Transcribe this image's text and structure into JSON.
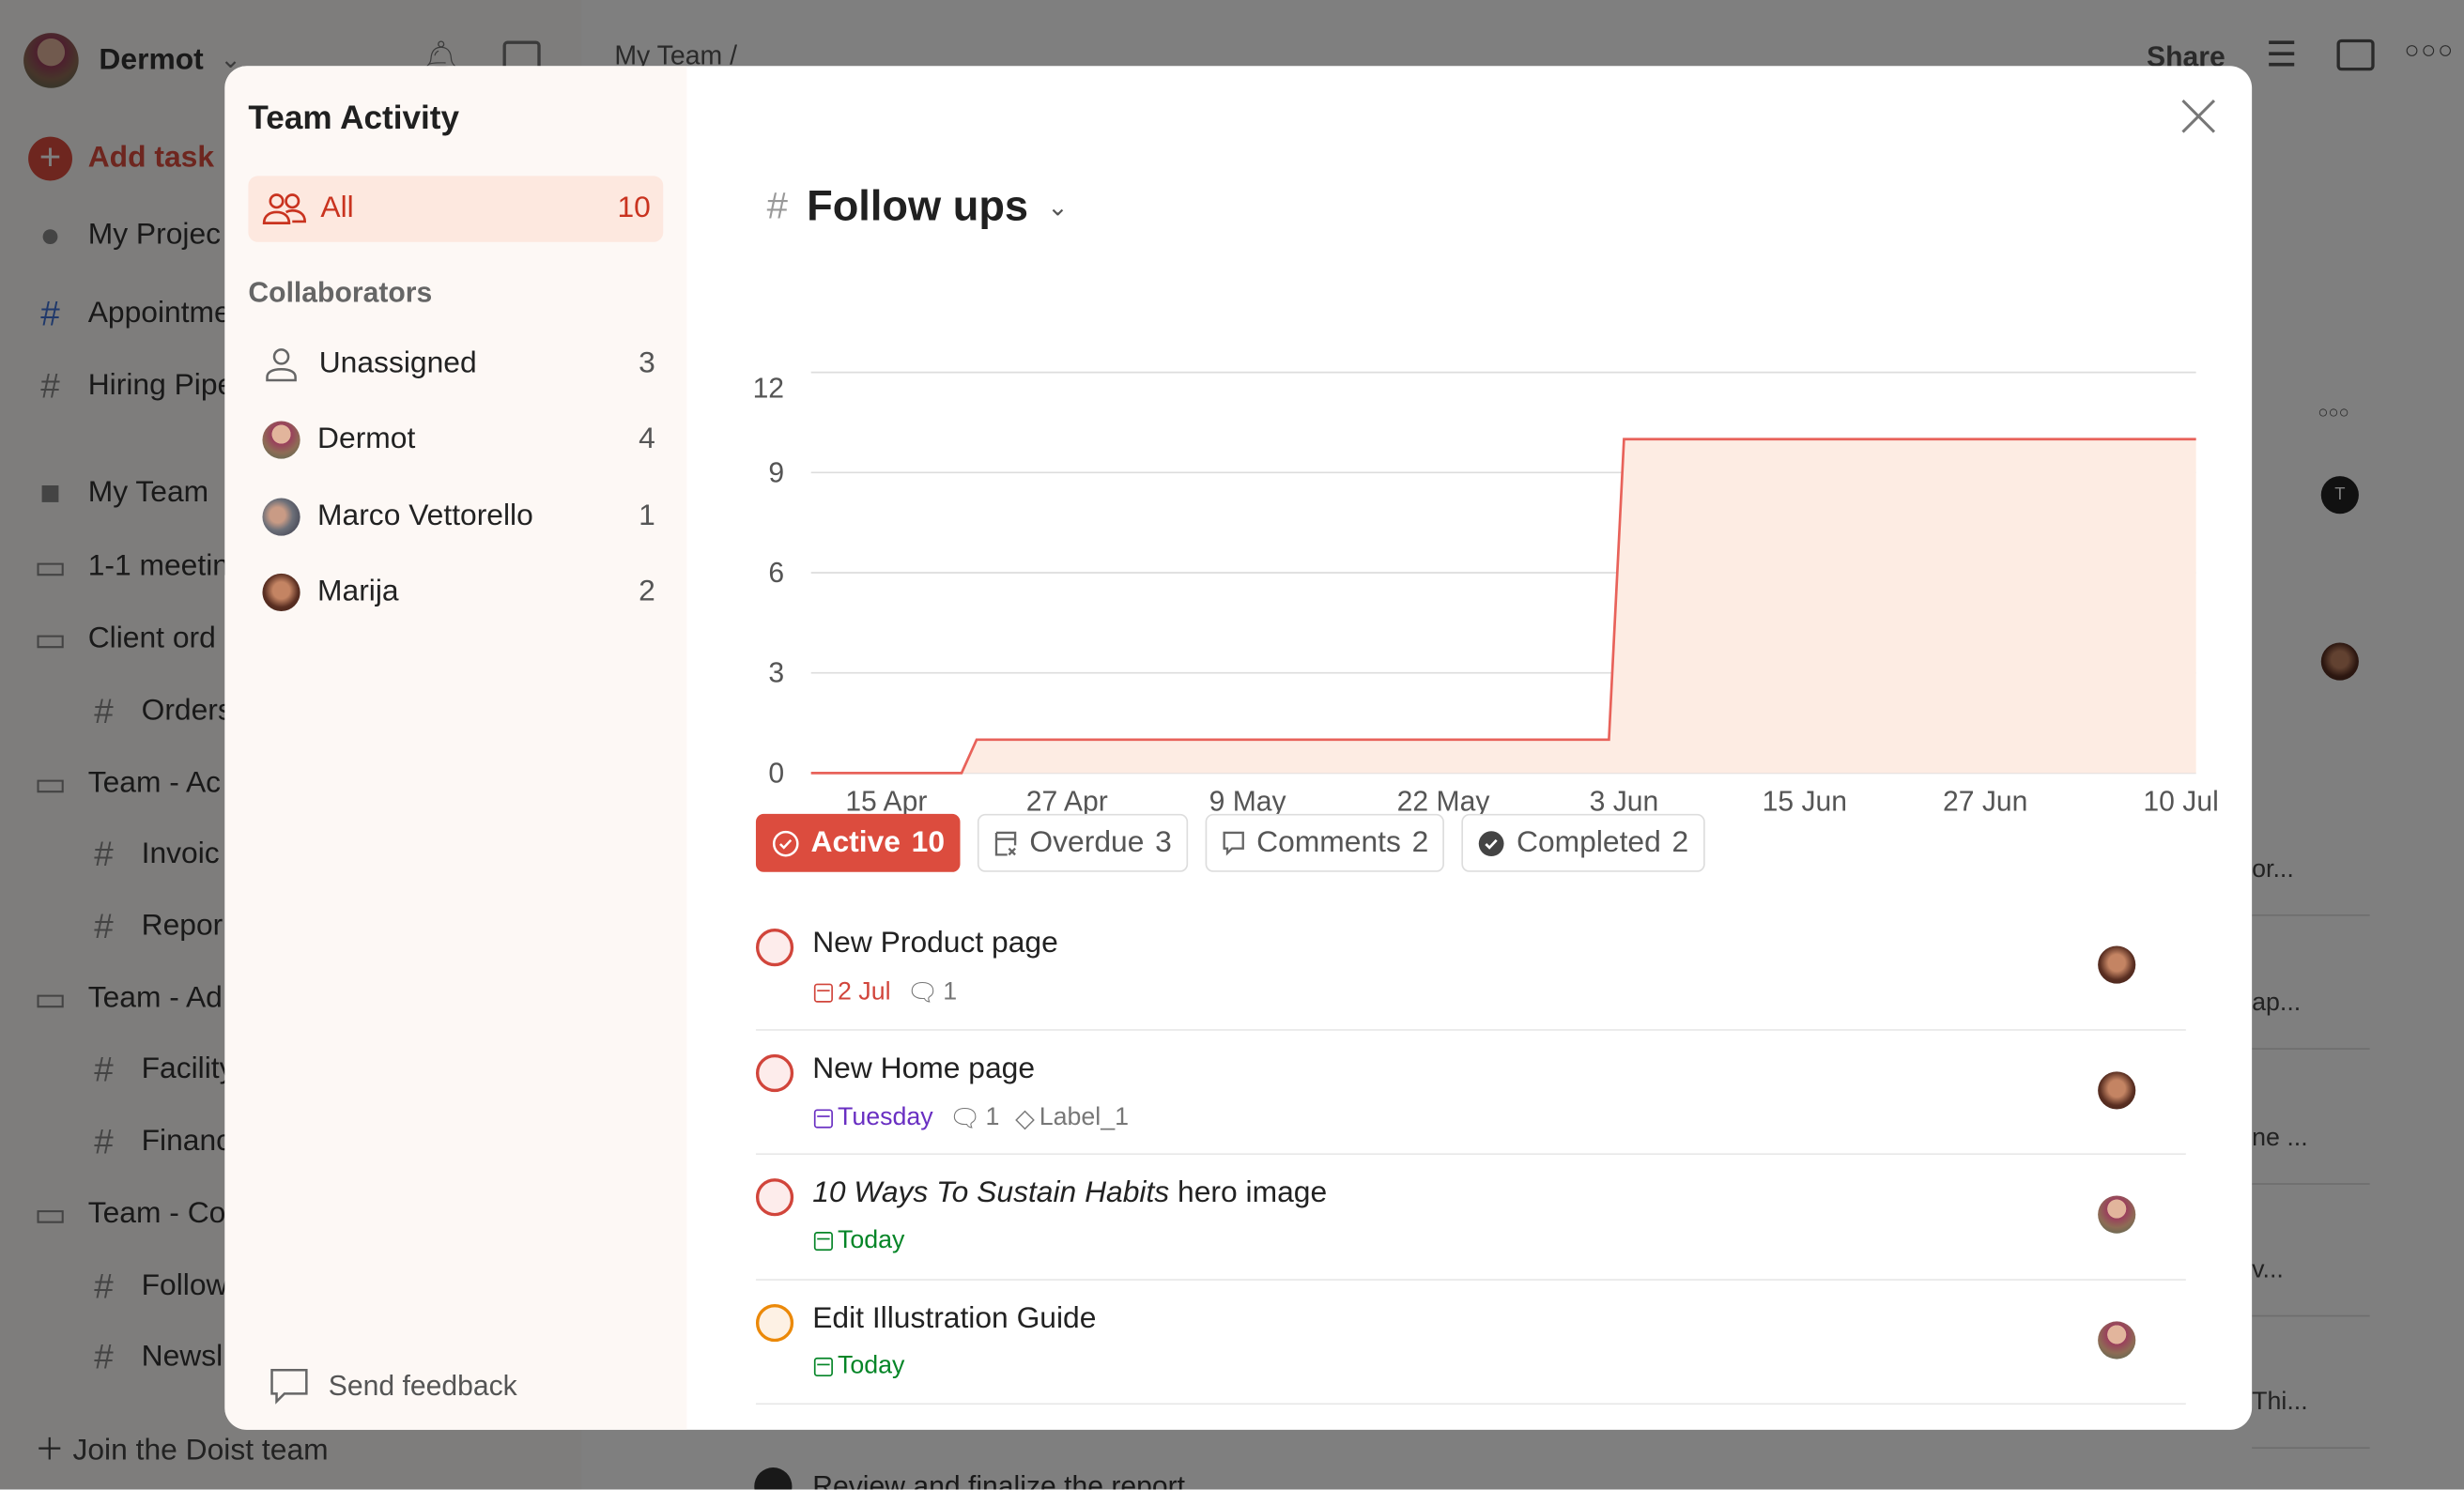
{
  "background": {
    "user_name": "Dermot",
    "add_task": "Add task",
    "sidebar_items": [
      {
        "label": "My Projec",
        "icon": "avatar",
        "top": 149
      },
      {
        "label": "Appointme",
        "icon": "hash-icon",
        "top": 199
      },
      {
        "label": "Hiring Pipe",
        "icon": "hash-icon",
        "top": 245
      },
      {
        "label": "My Team",
        "icon": "team-logo",
        "top": 313
      },
      {
        "label": "1-1 meetin",
        "icon": "folder-icon",
        "top": 360
      },
      {
        "label": "Client ord",
        "icon": "folder-icon",
        "top": 406
      },
      {
        "label": "Orders",
        "icon": "hash-icon",
        "top": 452
      },
      {
        "label": "Team - Ac",
        "icon": "folder-icon",
        "top": 498
      },
      {
        "label": "Invoic",
        "icon": "hash-icon",
        "top": 543
      },
      {
        "label": "Repor",
        "icon": "hash-icon",
        "top": 589
      },
      {
        "label": "Team - Ad",
        "icon": "folder-icon",
        "top": 635
      },
      {
        "label": "Facility",
        "icon": "hash-icon",
        "top": 680
      },
      {
        "label": "Financ",
        "icon": "hash-icon",
        "top": 726
      },
      {
        "label": "Team - Co",
        "icon": "folder-icon",
        "top": 772
      },
      {
        "label": "Follow",
        "icon": "hash-icon",
        "top": 818
      },
      {
        "label": "Newsl",
        "icon": "hash-icon",
        "top": 863
      }
    ],
    "join_team": "Join the Doist team",
    "breadcrumb": "My Team /",
    "share": "Share",
    "right_fragments": [
      "or...",
      "ap...",
      "ne ...",
      "v...",
      "Thi..."
    ],
    "bottom_task": "Review and finalize the report"
  },
  "modal": {
    "title": "Team Activity",
    "all": {
      "label": "All",
      "count": "10"
    },
    "collaborators_heading": "Collaborators",
    "collaborators": [
      {
        "name": "Unassigned",
        "count": "3"
      },
      {
        "name": "Dermot",
        "count": "4"
      },
      {
        "name": "Marco Vettorello",
        "count": "1"
      },
      {
        "name": "Marija",
        "count": "2"
      }
    ],
    "send_feedback": "Send feedback",
    "project": "Follow ups",
    "filters": [
      {
        "label": "Active",
        "count": "10",
        "icon": "check-circle-icon"
      },
      {
        "label": "Overdue",
        "count": "3",
        "icon": "overdue-calendar-icon"
      },
      {
        "label": "Comments",
        "count": "2",
        "icon": "comment-icon"
      },
      {
        "label": "Completed",
        "count": "2",
        "icon": "check-filled-icon"
      }
    ],
    "tasks": [
      {
        "name_italic": "",
        "name": "New Product page",
        "due": "2 Jul",
        "due_color": "#d1453b",
        "comments": "1",
        "label": "",
        "priority": "p1",
        "assignee": "Marija"
      },
      {
        "name_italic": "",
        "name": "New Home page",
        "due": "Tuesday",
        "due_color": "#692fc2",
        "comments": "1",
        "label": "Label_1",
        "priority": "p1",
        "assignee": "Marija"
      },
      {
        "name_italic": "10 Ways To Sustain Habits",
        "name": " hero image",
        "due": "Today",
        "due_color": "#058527",
        "comments": "",
        "label": "",
        "priority": "p1",
        "assignee": "Dermot"
      },
      {
        "name_italic": "",
        "name": "Edit Illustration Guide",
        "due": "Today",
        "due_color": "#058527",
        "comments": "",
        "label": "",
        "priority": "p2",
        "assignee": "Dermot"
      }
    ]
  },
  "colors": {
    "accent": "#dc4c3e",
    "chart_line": "#e8625a",
    "chart_fill": "#fdece3"
  },
  "chart_data": {
    "type": "area",
    "step": true,
    "x": [
      "10 Apr",
      "20 Apr",
      "21 Apr",
      "2 Jun",
      "3 Jun",
      "11 Jul"
    ],
    "y": [
      0,
      0,
      1,
      1,
      10,
      10
    ],
    "xticks": [
      "15 Apr",
      "27 Apr",
      "9 May",
      "22 May",
      "3 Jun",
      "15 Jun",
      "27 Jun",
      "10 Jul"
    ],
    "yticks": [
      0,
      3,
      6,
      9,
      12
    ],
    "ylim": [
      0,
      12
    ],
    "grid": true
  }
}
